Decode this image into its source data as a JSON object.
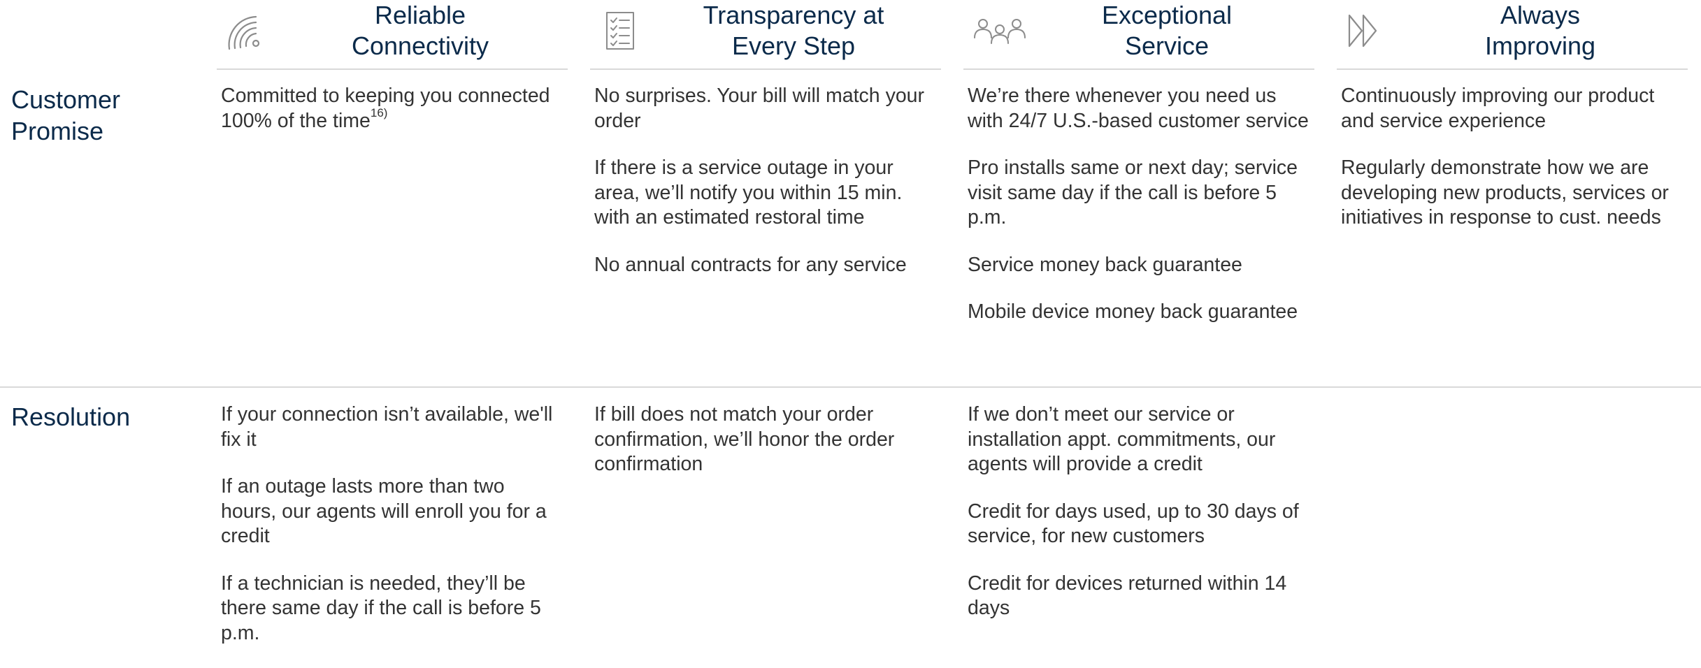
{
  "columns": [
    {
      "title_line1": "Reliable",
      "title_line2": "Connectivity",
      "icon": "wifi-signal-icon"
    },
    {
      "title_line1": "Transparency at",
      "title_line2": "Every Step",
      "icon": "checklist-icon"
    },
    {
      "title_line1": "Exceptional",
      "title_line2": "Service",
      "icon": "people-group-icon"
    },
    {
      "title_line1": "Always",
      "title_line2": "Improving",
      "icon": "fast-forward-icon"
    }
  ],
  "rows": {
    "promise": {
      "label_line1": "Customer",
      "label_line2": "Promise",
      "cells": [
        {
          "items": [
            "Committed to keeping you connected 100% of the time"
          ],
          "footnote": "16)"
        },
        {
          "items": [
            "No surprises. Your bill will match your order",
            "If there is a service outage in your area, we’ll notify you within 15 min. with an estimated restoral time",
            "No annual contracts for any service"
          ]
        },
        {
          "items": [
            "We’re there whenever you need us with 24/7 U.S.-based customer service",
            "Pro installs same or next day; service visit same day if the call is before 5 p.m.",
            "Service money back guarantee",
            "Mobile device money back guarantee"
          ]
        },
        {
          "items": [
            "Continuously improving our product and service experience",
            "Regularly demonstrate how we are developing new products, services or initiatives in response to cust. needs"
          ]
        }
      ]
    },
    "resolution": {
      "label": "Resolution",
      "cells": [
        {
          "items": [
            "If your connection isn’t available, we'll fix it",
            "If an outage lasts more than two hours, our agents will enroll you for a credit",
            "If a technician is needed, they’ll be there same day if the call is before 5 p.m."
          ]
        },
        {
          "items": [
            "If bill does not match your order confirmation, we’ll honor the order confirmation"
          ]
        },
        {
          "items": [
            "If we don’t meet our service or installation appt. commitments, our agents will provide a credit",
            "Credit for days used, up to 30 days of service, for new customers",
            "Credit for devices returned within 14 days"
          ]
        },
        {
          "items": []
        }
      ]
    }
  },
  "colors": {
    "heading": "#0b2a4a",
    "body_text": "#333333",
    "rule": "#d9d9d9",
    "icon": "#8c8c8c"
  }
}
